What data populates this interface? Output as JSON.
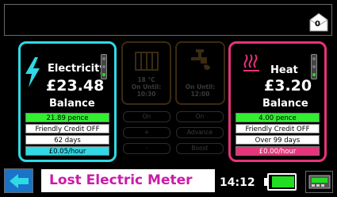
{
  "header": {
    "message_count": "0"
  },
  "electricity": {
    "title": "Electricity",
    "amount": "£23.48",
    "label": "Balance",
    "rows": [
      "21.89 pence",
      "Friendly Credit OFF",
      "62 days",
      "£0.05/hour"
    ]
  },
  "heating": {
    "temperature": "18 °C",
    "on_until_label": "On Until:",
    "on_until": "10:30",
    "buttons": [
      "On",
      "+",
      "-"
    ]
  },
  "hot_water": {
    "on_until_label": "On Until:",
    "on_until": "12:00",
    "buttons": [
      "On",
      "Advance",
      "Boost"
    ]
  },
  "heat": {
    "title": "Heat",
    "amount": "£3.20",
    "label": "Balance",
    "rows": [
      "4.00 pence",
      "Friendly Credit OFF",
      "Over 99 days",
      "£0.00/hour"
    ]
  },
  "footer": {
    "title": "Lost Electric Meter",
    "time": "14:12"
  },
  "colors": {
    "electricity_accent": "#2fd9e6",
    "heat_accent": "#e6337a",
    "positive": "#33ee33",
    "title_text": "#cc1aa8"
  },
  "icons": [
    "envelope-icon",
    "lightning-icon",
    "radiator-icon",
    "tap-icon",
    "heat-waves-icon",
    "traffic-light-icon",
    "back-arrow-icon",
    "battery-icon",
    "meter-icon"
  ]
}
